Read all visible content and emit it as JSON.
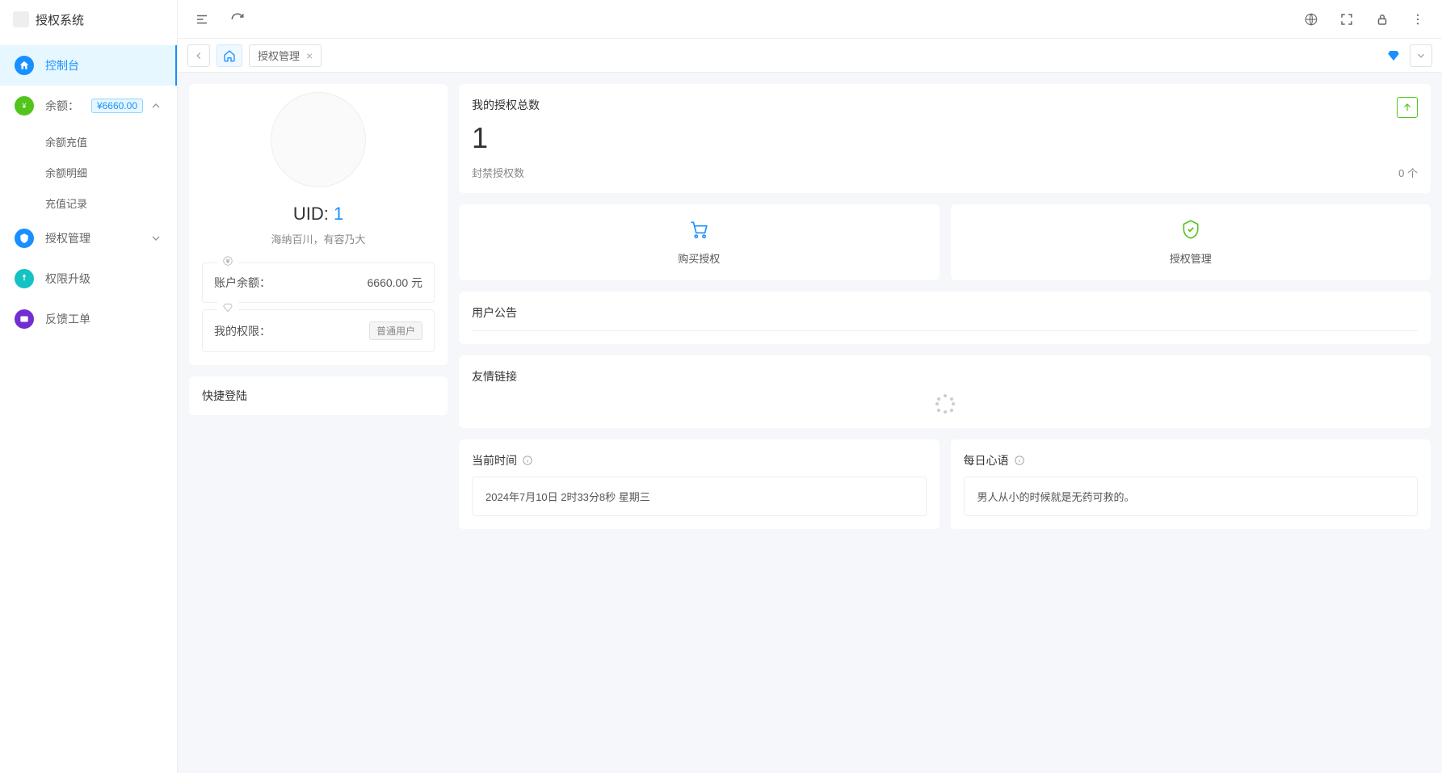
{
  "app": {
    "title": "授权系统"
  },
  "sidebar": {
    "items": [
      {
        "label": "控制台"
      },
      {
        "label": "余额：",
        "badge": "¥6660.00"
      },
      {
        "label": "授权管理"
      },
      {
        "label": "权限升级"
      },
      {
        "label": "反馈工单"
      }
    ],
    "balance_subs": [
      {
        "label": "余额充值"
      },
      {
        "label": "余额明细"
      },
      {
        "label": "充值记录"
      }
    ]
  },
  "tabs": {
    "current": "授权管理"
  },
  "profile": {
    "uid_label": "UID: ",
    "uid_value": "1",
    "motto": "海纳百川，有容乃大",
    "balance_label": "账户余额：",
    "balance_value": "6660.00 元",
    "perm_label": "我的权限：",
    "perm_value": "普通用户"
  },
  "quick_login": {
    "title": "快捷登陆"
  },
  "stats": {
    "title": "我的授权总数",
    "total": "1",
    "banned_label": "封禁授权数",
    "banned_value": "0 个"
  },
  "actions": {
    "buy": "购买授权",
    "manage": "授权管理"
  },
  "announce": {
    "title": "用户公告"
  },
  "links": {
    "title": "友情链接"
  },
  "time": {
    "title": "当前时间",
    "value": "2024年7月10日 2时33分8秒 星期三"
  },
  "daily": {
    "title": "每日心语",
    "value": "男人从小的时候就是无药可救的。"
  }
}
